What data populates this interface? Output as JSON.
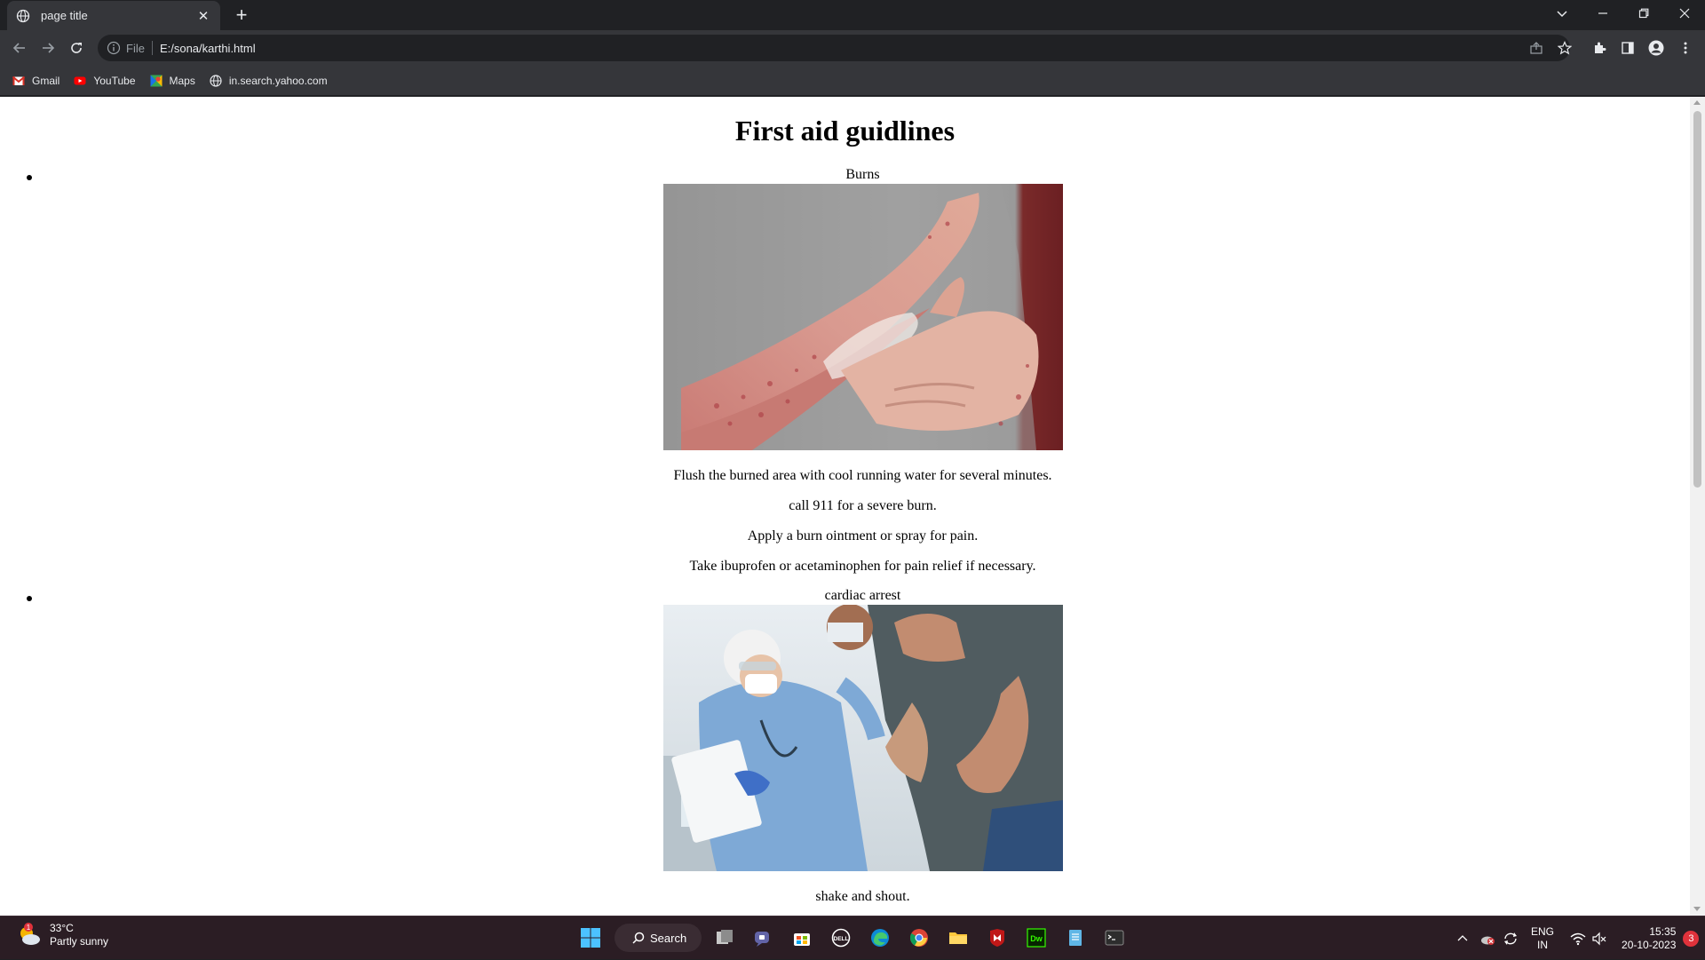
{
  "browser": {
    "tab_title": "page title",
    "url_scheme": "File",
    "url": "E:/sona/karthi.html",
    "bookmarks": [
      {
        "label": "Gmail",
        "icon": "gmail-icon"
      },
      {
        "label": "YouTube",
        "icon": "youtube-icon"
      },
      {
        "label": "Maps",
        "icon": "maps-icon"
      },
      {
        "label": "in.search.yahoo.com",
        "icon": "globe-icon"
      }
    ]
  },
  "page": {
    "heading": "First aid guidlines",
    "items": [
      {
        "label": "Burns",
        "image": "burned-arm-photo",
        "paragraphs": [
          "Flush the burned area with cool running water for several minutes.",
          "call 911 for a severe burn.",
          "Apply a burn ointment or spray for pain.",
          "Take ibuprofen or acetaminophen for pain relief if necessary."
        ]
      },
      {
        "label": "cardiac arrest",
        "image": "doctor-helping-patient-photo",
        "paragraphs": [
          "shake and shout."
        ]
      }
    ]
  },
  "taskbar": {
    "weather_temp": "33°C",
    "weather_desc": "Partly sunny",
    "weather_badge": "1",
    "search_label": "Search",
    "lang_top": "ENG",
    "lang_bottom": "IN",
    "time": "15:35",
    "date": "20-10-2023",
    "notification_count": "3"
  }
}
